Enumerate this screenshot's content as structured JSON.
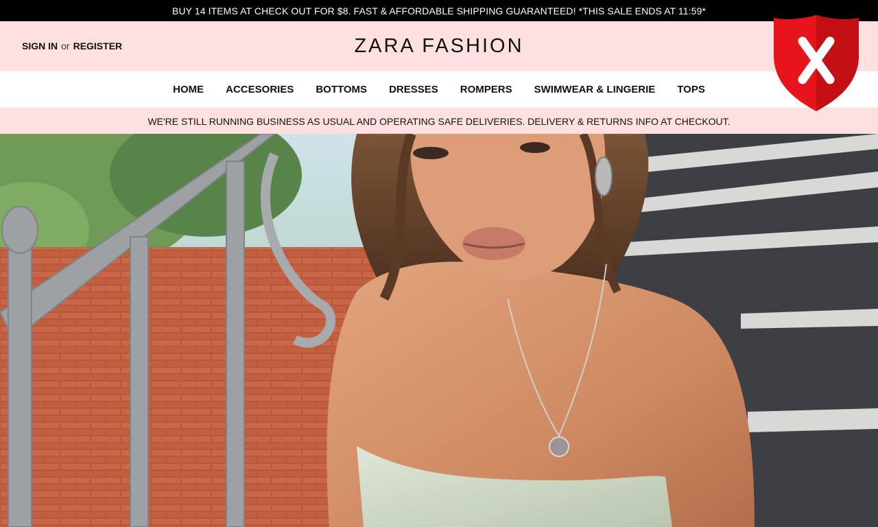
{
  "announcement": {
    "text": "BUY 14 ITEMS AT CHECK OUT FOR $8. FAST & AFFORDABLE SHIPPING GUARANTEED! *THIS SALE ENDS AT 11:59*"
  },
  "header": {
    "sign_in": "SIGN IN",
    "or": "or",
    "register": "REGISTER",
    "logo": "ZARA FASHION"
  },
  "nav": {
    "items": [
      {
        "label": "HOME"
      },
      {
        "label": "ACCESORIES"
      },
      {
        "label": "BOTTOMS"
      },
      {
        "label": "DRESSES"
      },
      {
        "label": "ROMPERS"
      },
      {
        "label": "SWIMWEAR & LINGERIE"
      },
      {
        "label": "TOPS"
      }
    ]
  },
  "notice": {
    "text": "WE'RE STILL RUNNING BUSINESS AS USUAL AND OPERATING SAFE DELIVERIES. DELIVERY & RETURNS INFO AT CHECKOUT."
  },
  "overlay": {
    "icon": "shield-x-icon",
    "shield_color": "#e8141b"
  },
  "colors": {
    "header_bg": "#ffe0e0",
    "announce_bg": "#000000"
  }
}
